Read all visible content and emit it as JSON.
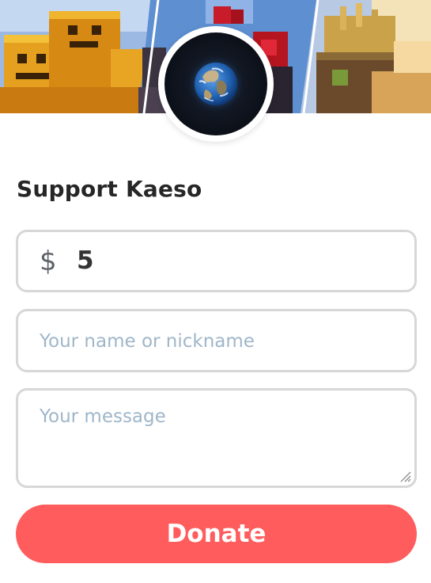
{
  "profile": {
    "heading": "Support Kaeso"
  },
  "banner": {
    "icon": "minecraft-banner"
  },
  "avatar": {
    "icon": "earth-icon"
  },
  "form": {
    "currency_symbol": "$",
    "amount_value": "5",
    "name_placeholder": "Your name or nickname",
    "message_placeholder": "Your message",
    "donate_label": "Donate"
  },
  "colors": {
    "accent": "#ff5d5d",
    "border": "#d7d7d7",
    "placeholder": "#9fb6c9",
    "heading": "#262626"
  }
}
